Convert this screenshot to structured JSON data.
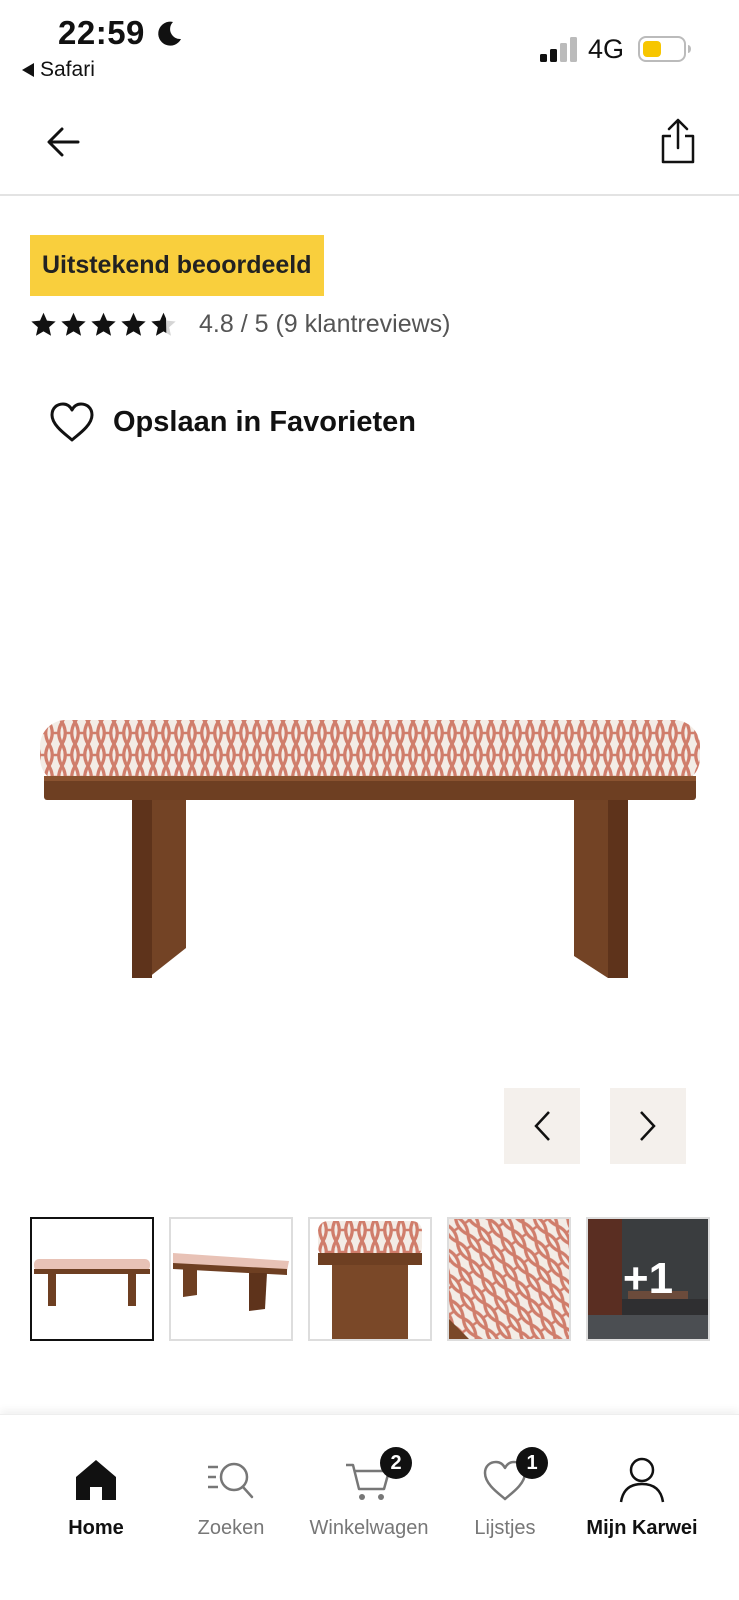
{
  "status_bar": {
    "time": "22:59",
    "back_app": "Safari",
    "network": "4G"
  },
  "badge": "Uitstekend beoordeeld",
  "rating": {
    "value": 4.8,
    "max": 5,
    "text": "4.8 / 5 (9 klantreviews)"
  },
  "favorite_label": "Opslaan in Favorieten",
  "gallery": {
    "more_count": "+1"
  },
  "tabs": [
    {
      "label": "Home",
      "icon": "home-icon"
    },
    {
      "label": "Zoeken",
      "icon": "search-icon"
    },
    {
      "label": "Winkelwagen",
      "icon": "cart-icon",
      "badge": "2"
    },
    {
      "label": "Lijstjes",
      "icon": "heart-icon",
      "badge": "1"
    },
    {
      "label": "Mijn Karwei",
      "icon": "user-icon"
    }
  ],
  "colors": {
    "badge_bg": "#f9cf3d",
    "arrow_bg": "#f4f0ec",
    "battery": "#f7c600"
  }
}
